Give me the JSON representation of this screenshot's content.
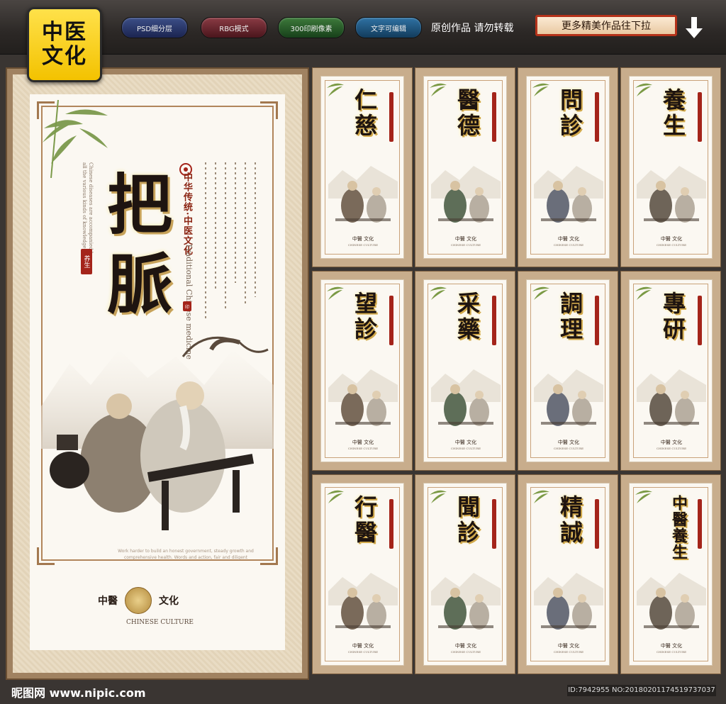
{
  "header": {
    "logo_line1": "中医",
    "logo_line2": "文化",
    "badges": [
      "PSD细分层",
      "RBG模式",
      "300印刷像素",
      "文字可编辑"
    ],
    "notice": "原创作品 请勿转载",
    "more_button": "更多精美作品往下拉"
  },
  "main_poster": {
    "title_line1": "把",
    "title_line2": "脈",
    "subtitle": "中华传统·中医文化",
    "english_subtitle": "Traditional Chinese medicine",
    "brand_left": "中醫",
    "brand_right": "文化",
    "brand_en": "CHINESE CULTURE",
    "seal_text": "养生"
  },
  "thumbnails": [
    {
      "title": "仁慈"
    },
    {
      "title": "醫德"
    },
    {
      "title": "問診"
    },
    {
      "title": "養生"
    },
    {
      "title": "望診"
    },
    {
      "title": "采藥"
    },
    {
      "title": "調理"
    },
    {
      "title": "專研"
    },
    {
      "title": "行醫"
    },
    {
      "title": "聞診"
    },
    {
      "title": "精誠"
    },
    {
      "title": "中醫養生"
    }
  ],
  "thumbnail_brand": "中醫 文化",
  "thumbnail_brand_en": "CHINESE CULTURE",
  "footer": {
    "site": "昵图网 www.nipic.com",
    "id_text": "ID:7942955 NO:20180201174519737037"
  }
}
